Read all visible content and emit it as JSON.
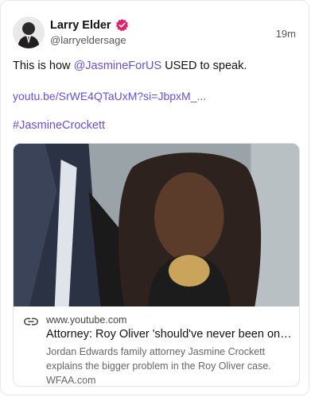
{
  "author": {
    "name": "Larry Elder",
    "handle": "@larryeldersage",
    "verified_color": "#e2216b"
  },
  "post": {
    "time": "19m",
    "text_prefix": "This is how ",
    "mention": "@JasmineForUS",
    "text_suffix": " USED to speak.",
    "link": "youtu.be/SrWE4QTaUxM?si=JbpxM_...",
    "hashtag": "#JasmineCrockett"
  },
  "link_preview": {
    "domain": "www.youtube.com",
    "title": "Attorney: Roy Oliver 'should've never been on t...",
    "description": "Jordan Edwards family attorney Jasmine Crockett explains the bigger problem in the Roy Oliver case. WFAA.com",
    "icon": "link-icon"
  },
  "colors": {
    "accent": "#6a4fd6",
    "text": "#111111",
    "muted": "#555555"
  }
}
